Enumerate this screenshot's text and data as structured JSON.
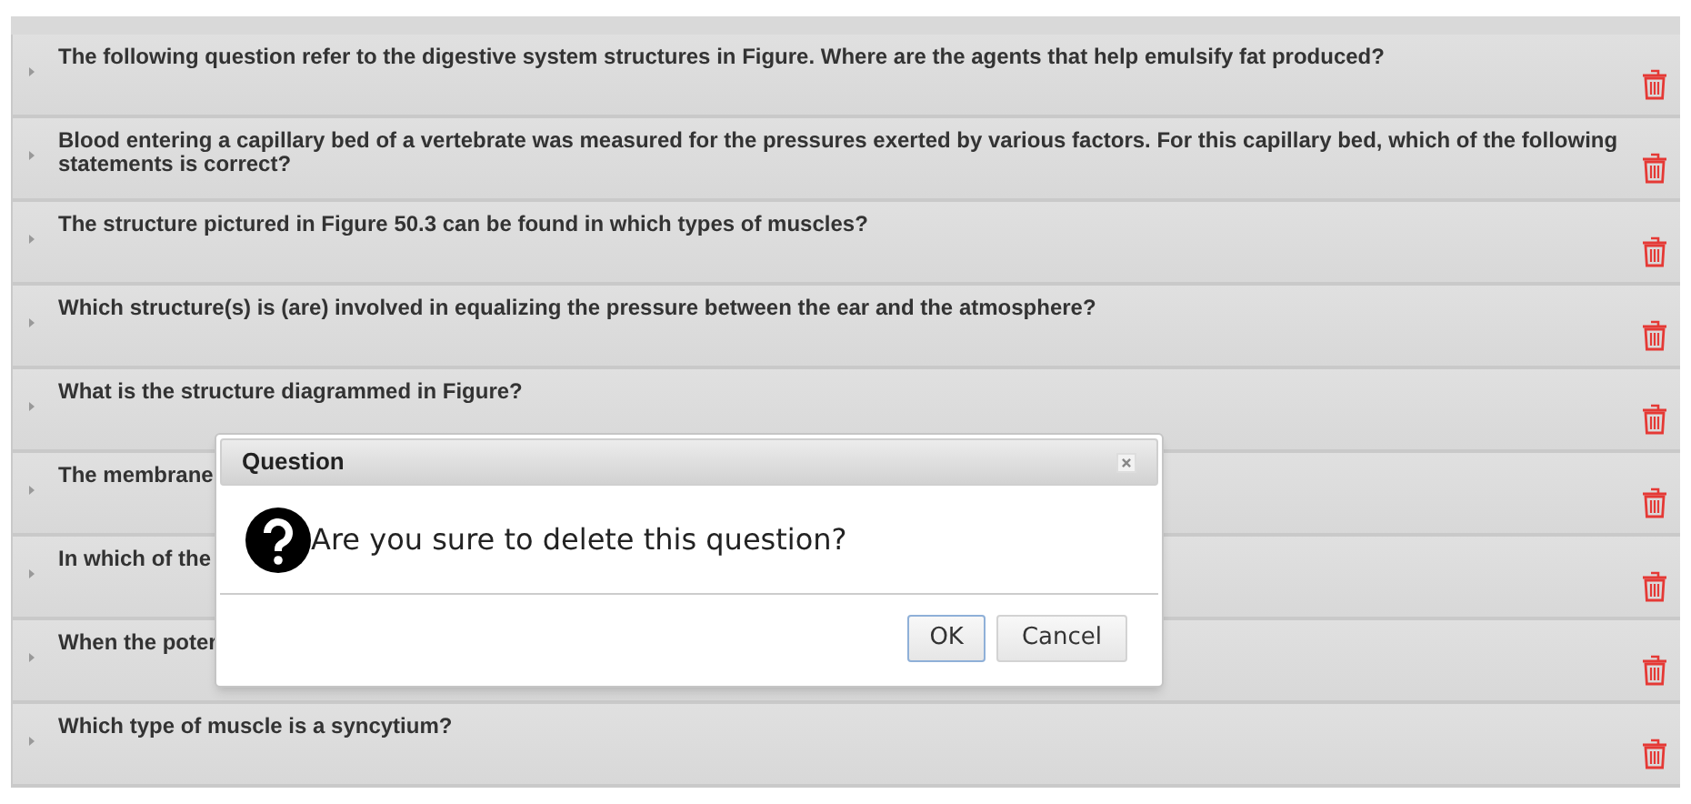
{
  "questions": [
    {
      "text": "The following question refer to the digestive system structures in Figure. Where are the agents that help emulsify fat produced?"
    },
    {
      "text": "Blood entering a capillary bed of a vertebrate was measured for the pressures exerted by various factors. For this capillary bed, which of the following statements is correct?"
    },
    {
      "text": "The structure pictured in Figure 50.3 can be found in which types of muscles?"
    },
    {
      "text": "Which structure(s) is (are) involved in equalizing the pressure between the ear and the atmosphere?"
    },
    {
      "text": "What is the structure diagrammed in Figure?"
    },
    {
      "text": "The membrane"
    },
    {
      "text": "In which of the"
    },
    {
      "text": "When the poter"
    },
    {
      "text": "Which type of muscle is a syncytium?"
    }
  ],
  "dialog": {
    "title": "Question",
    "message": "Are you sure to delete this question?",
    "buttons": [
      {
        "label": "OK",
        "selected": true
      },
      {
        "label": "Cancel",
        "selected": false
      }
    ]
  }
}
